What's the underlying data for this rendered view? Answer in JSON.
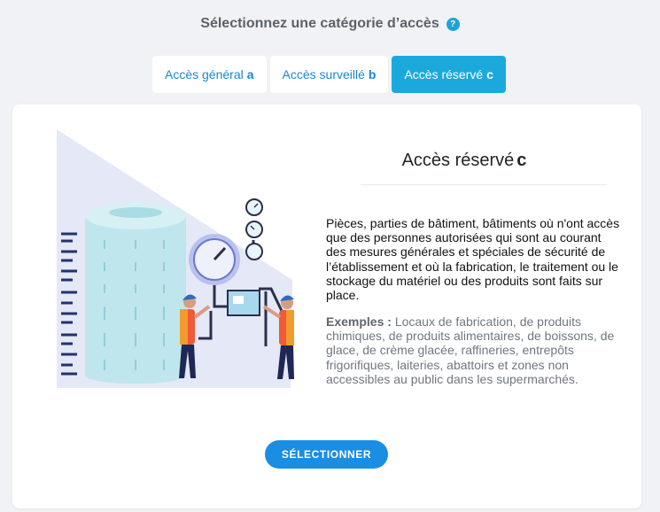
{
  "header": {
    "title": "Sélectionnez une catégorie d’accès",
    "help_icon": "?"
  },
  "tabs": [
    {
      "label": "Accès général",
      "letter": "a",
      "active": false
    },
    {
      "label": "Accès surveillé",
      "letter": "b",
      "active": false
    },
    {
      "label": "Accès réservé",
      "letter": "c",
      "active": true
    }
  ],
  "card": {
    "title": "Accès réservé",
    "title_letter": "c",
    "description": "Pièces, parties de bâtiment, bâtiments où n'ont accès que des personnes autorisées qui sont au courant des mesures générales et spéciales de sécurité de l’établissement et où la fabrication, le traitement ou le stockage du matériel ou des produits sont faits sur place.",
    "examples_label": "Exemples :",
    "examples_text": "Locaux de fabrication, de produits chimiques, de produits alimentaires, de boissons, de glace, de crème glacée, raffineries, entrepôts frigorifiques, laiteries, abattoirs et zones non accessibles au public dans les supermarchés.",
    "select_button": "SÉLECTIONNER"
  },
  "colors": {
    "accent": "#1a8ee2",
    "tab_active": "#1ba9dc",
    "link": "#1a86d2",
    "background": "#f1f2f5"
  },
  "icons": [
    "help-icon",
    "industrial-workers-illustration"
  ]
}
